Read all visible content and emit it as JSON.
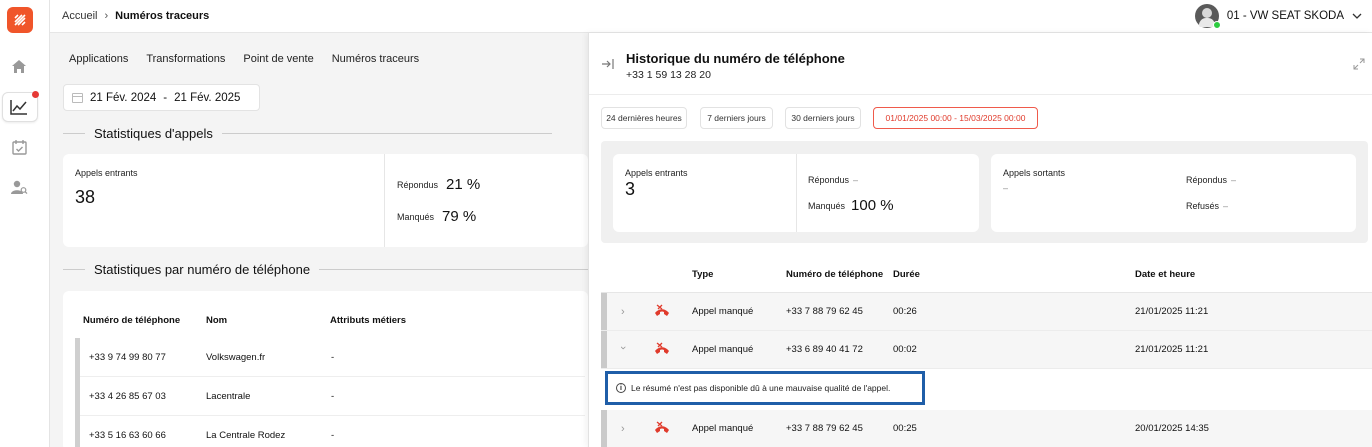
{
  "app": {
    "brand_color": "#f0552a"
  },
  "breadcrumb": {
    "home": "Accueil",
    "current": "Numéros traceurs"
  },
  "user": {
    "name": "01 - VW SEAT SKODA"
  },
  "tabs": [
    "Applications",
    "Transformations",
    "Point de vente",
    "Numéros traceurs"
  ],
  "date_range": {
    "start": "21 Fév. 2024",
    "separator": "-",
    "end": "21 Fév. 2025"
  },
  "call_stats": {
    "title": "Statistiques d'appels",
    "incoming_label": "Appels entrants",
    "incoming_value": "38",
    "answered_label": "Répondus",
    "answered_value": "21 %",
    "missed_label": "Manqués",
    "missed_value": "79 %"
  },
  "phone_stats": {
    "title": "Statistiques par numéro de téléphone",
    "columns": [
      "Numéro de téléphone",
      "Nom",
      "Attributs métiers"
    ],
    "rows": [
      {
        "phone": "+33 9 74 99 80 77",
        "name": "Volkswagen.fr",
        "attrs": "-"
      },
      {
        "phone": "+33 4 26 85 67 03",
        "name": "Lacentrale",
        "attrs": "-"
      },
      {
        "phone": "+33 5 16 63 60 66",
        "name": "La Centrale Rodez",
        "attrs": "-"
      }
    ]
  },
  "panel": {
    "title": "Historique du numéro de téléphone",
    "phone": "+33 1 59 13 28 20",
    "chips": [
      "24 dernières heures",
      "7 derniers jours",
      "30 derniers jours",
      "01/01/2025 00:00 - 15/03/2025 00:00"
    ],
    "accent_color": "#e03b2c",
    "incoming": {
      "label": "Appels entrants",
      "value": "3",
      "answered_label": "Répondus",
      "answered_value": "–",
      "missed_label": "Manqués",
      "missed_value": "100 %"
    },
    "outgoing": {
      "label": "Appels sortants",
      "value": "–",
      "answered_label": "Répondus",
      "answered_value": "–",
      "refused_label": "Refusés",
      "refused_value": "–"
    },
    "table": {
      "columns": {
        "type": "Type",
        "phone": "Numéro de téléphone",
        "duration": "Durée",
        "datetime": "Date et heure"
      },
      "rows": [
        {
          "type": "Appel manqué",
          "phone": "+33 7 88 79 62 45",
          "duration": "00:26",
          "datetime": "21/01/2025 11:21",
          "expanded": false
        },
        {
          "type": "Appel manqué",
          "phone": "+33 6 89 40 41 72",
          "duration": "00:02",
          "datetime": "21/01/2025 11:21",
          "expanded": true
        },
        {
          "type": "Appel manqué",
          "phone": "+33 7 88 79 62 45",
          "duration": "00:25",
          "datetime": "20/01/2025 14:35",
          "expanded": false
        }
      ],
      "notice": "Le résumé n'est pas disponible dû à une mauvaise qualité de l'appel."
    }
  }
}
